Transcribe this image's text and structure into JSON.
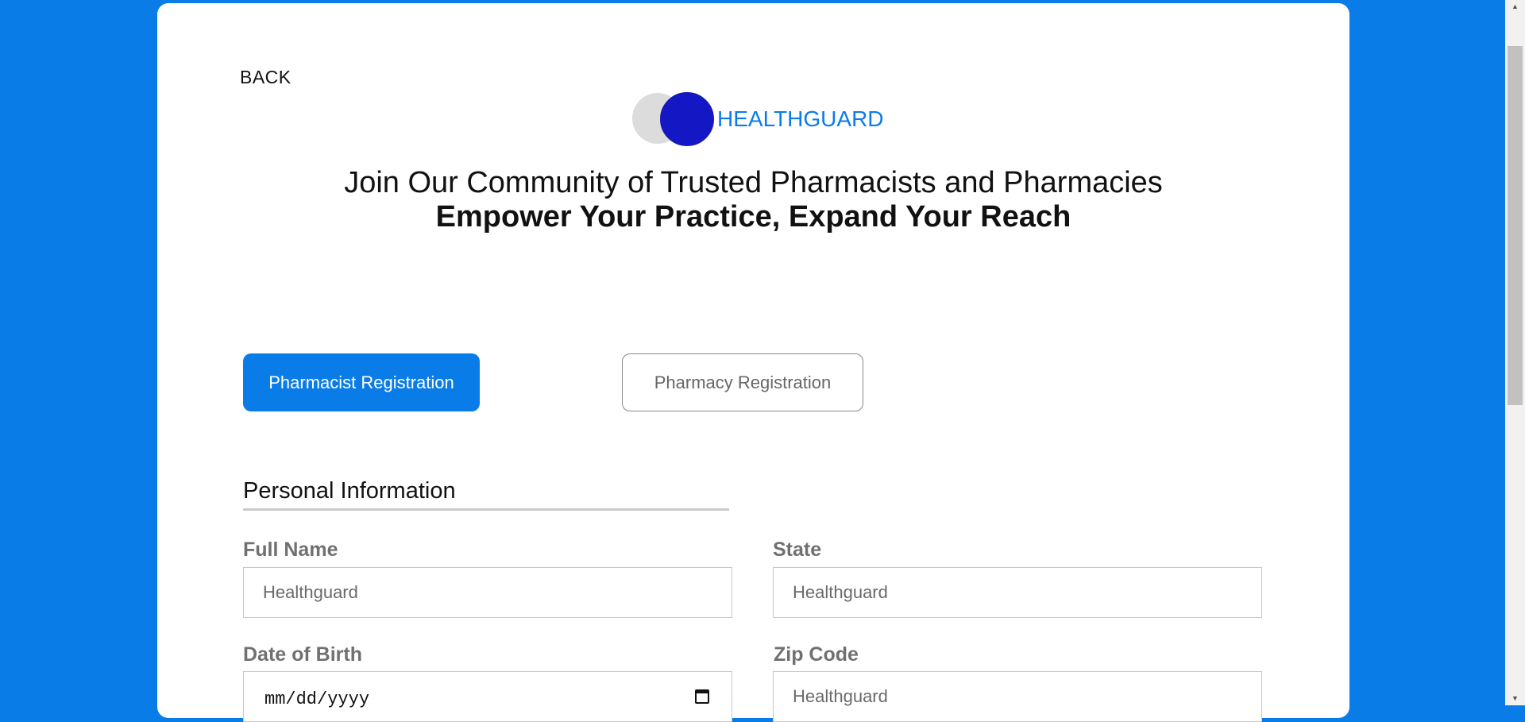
{
  "nav": {
    "back_label": "BACK"
  },
  "brand": {
    "name": "HEALTHGUARD",
    "color": "#0a7ce8",
    "icon": "two-circles-logo"
  },
  "hero": {
    "line1": "Join Our Community of Trusted Pharmacists and Pharmacies",
    "line2": "Empower Your Practice, Expand Your Reach"
  },
  "tabs": [
    {
      "label": "Pharmacist Registration",
      "active": true
    },
    {
      "label": "Pharmacy Registration",
      "active": false
    }
  ],
  "section": {
    "title": "Personal Information"
  },
  "form": {
    "full_name": {
      "label": "Full Name",
      "placeholder": "Healthguard"
    },
    "state": {
      "label": "State",
      "placeholder": "Healthguard"
    },
    "dob": {
      "label": "Date of Birth",
      "placeholder": "mm/dd/yyyy"
    },
    "zip": {
      "label": "Zip Code",
      "placeholder": "Healthguard"
    }
  },
  "colors": {
    "background": "#0a7ce8",
    "accent": "#0a7ce8",
    "logo_dark_circle": "#1418c4"
  }
}
